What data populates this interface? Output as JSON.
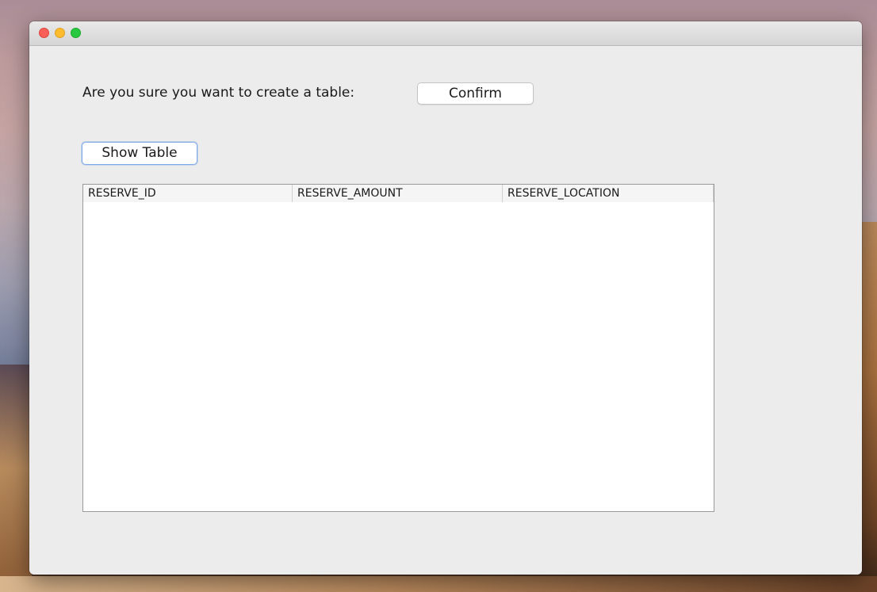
{
  "dialog": {
    "prompt": "Are you sure you want to create a table:",
    "confirm_label": "Confirm",
    "show_table_label": "Show Table"
  },
  "table": {
    "columns": [
      "RESERVE_ID",
      "RESERVE_AMOUNT",
      "RESERVE_LOCATION"
    ],
    "rows": []
  },
  "colors": {
    "window_bg": "#ececec",
    "close": "#fc5f57",
    "minimize": "#fdbc2e",
    "maximize": "#28c840",
    "focus_ring": "#7ea9e6"
  }
}
